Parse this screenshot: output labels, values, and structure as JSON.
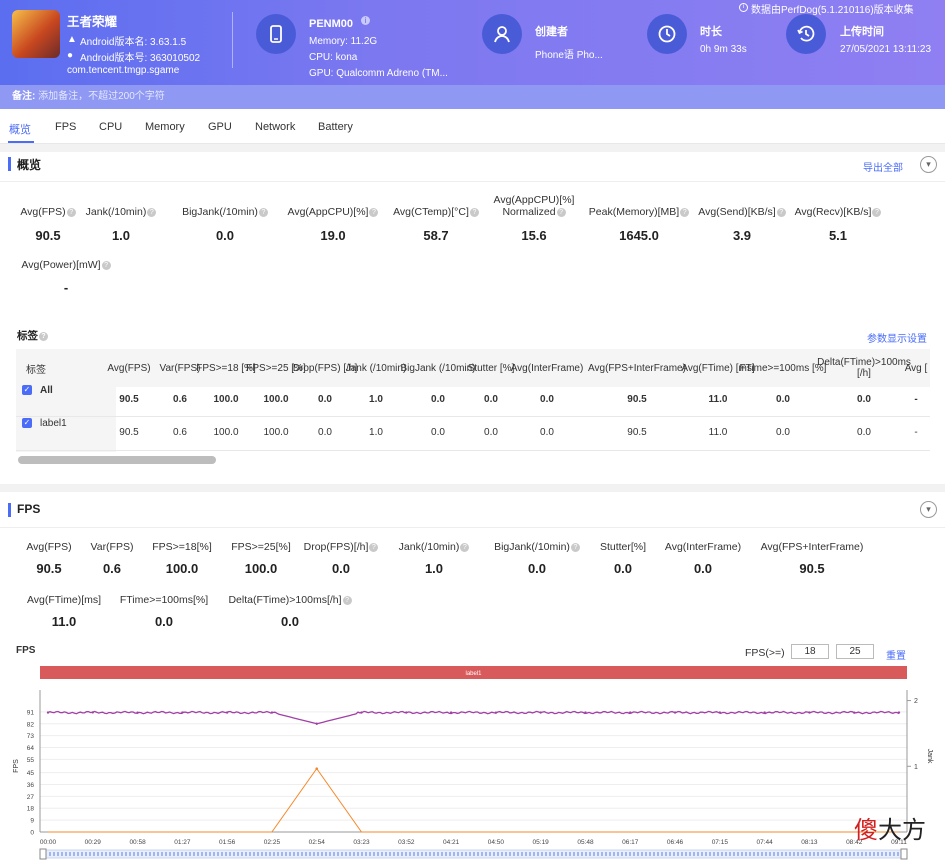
{
  "header": {
    "app_name": "王者荣耀",
    "android_name": "Android版本名: 3.63.1.5",
    "android_code": "Android版本号: 363010502",
    "package": "com.tencent.tmgp.sgame",
    "device": {
      "name": "PENM00",
      "memory": "Memory: 11.2G",
      "cpu": "CPU: kona",
      "gpu": "GPU: Qualcomm Adreno (TM..."
    },
    "creator": {
      "label": "创建者",
      "value": "Phone语 Pho..."
    },
    "duration": {
      "label": "时长",
      "value": "0h 9m 33s"
    },
    "upload": {
      "label": "上传时间",
      "value": "27/05/2021 13:11:23"
    },
    "source": "数据由PerfDog(5.1.210116)版本收集"
  },
  "note": {
    "label": "备注:",
    "placeholder": "添加备注，不超过200个字符"
  },
  "tabs": [
    "概览",
    "FPS",
    "CPU",
    "Memory",
    "GPU",
    "Network",
    "Battery"
  ],
  "overview": {
    "title": "概览",
    "export": "导出全部",
    "metrics": [
      {
        "label": "Avg(FPS)",
        "value": "90.5"
      },
      {
        "label": "Jank(/10min)",
        "value": "1.0"
      },
      {
        "label": "BigJank(/10min)",
        "value": "0.0"
      },
      {
        "label": "Avg(AppCPU)[%]",
        "value": "19.0"
      },
      {
        "label": "Avg(CTemp)[°C]",
        "value": "58.7"
      },
      {
        "label": "Avg(AppCPU)[%]",
        "label2": "Normalized",
        "value": "15.6"
      },
      {
        "label": "Peak(Memory)[MB]",
        "value": "1645.0"
      },
      {
        "label": "Avg(Send)[KB/s]",
        "value": "3.9"
      },
      {
        "label": "Avg(Recv)[KB/s]",
        "value": "5.1"
      },
      {
        "label": "Avg(Power)[mW]",
        "value": "-"
      }
    ]
  },
  "labels": {
    "title": "标签",
    "settings": "参数显示设置",
    "columns": [
      "标签",
      "Avg(FPS)",
      "Var(FPS)",
      "FPS>=18 [%]",
      "FPS>=25 [%]",
      "Drop(FPS) [/h]",
      "Jank (/10min)",
      "BigJank (/10min)",
      "Stutter [%]",
      "Avg(InterFrame)",
      "Avg(FPS+InterFrame)",
      "Avg(FTime) [ms]",
      "FTime>=100ms [%]",
      "Delta(FTime)>100ms [/h]",
      "Avg ["
    ],
    "rows": [
      {
        "name": "All",
        "values": [
          "90.5",
          "0.6",
          "100.0",
          "100.0",
          "0.0",
          "1.0",
          "0.0",
          "0.0",
          "0.0",
          "90.5",
          "11.0",
          "0.0",
          "0.0",
          "-"
        ]
      },
      {
        "name": "label1",
        "values": [
          "90.5",
          "0.6",
          "100.0",
          "100.0",
          "0.0",
          "1.0",
          "0.0",
          "0.0",
          "0.0",
          "90.5",
          "11.0",
          "0.0",
          "0.0",
          "-"
        ]
      }
    ]
  },
  "fps_section": {
    "title": "FPS",
    "metrics": [
      {
        "label": "Avg(FPS)",
        "value": "90.5"
      },
      {
        "label": "Var(FPS)",
        "value": "0.6"
      },
      {
        "label": "FPS>=18[%]",
        "value": "100.0"
      },
      {
        "label": "FPS>=25[%]",
        "value": "100.0"
      },
      {
        "label": "Drop(FPS)[/h]",
        "value": "0.0"
      },
      {
        "label": "Jank(/10min)",
        "value": "1.0"
      },
      {
        "label": "BigJank(/10min)",
        "value": "0.0"
      },
      {
        "label": "Stutter[%]",
        "value": "0.0"
      },
      {
        "label": "Avg(InterFrame)",
        "value": "0.0"
      },
      {
        "label": "Avg(FPS+InterFrame)",
        "value": "90.5"
      },
      {
        "label": "Avg(FTime)[ms]",
        "value": "11.0"
      },
      {
        "label": "FTime>=100ms[%]",
        "value": "0.0"
      },
      {
        "label": "Delta(FTime)>100ms[/h]",
        "value": "0.0"
      }
    ],
    "chart_title": "FPS",
    "fps_threshold_label": "FPS(>=)",
    "fps_threshold_1": "18",
    "fps_threshold_2": "25",
    "reset": "重置",
    "band_label": "label1"
  },
  "chart_data": {
    "type": "line",
    "title": "FPS",
    "ylabel": "FPS",
    "y2label": "Jank",
    "yticks": [
      0,
      9,
      18,
      27,
      36,
      45,
      55,
      64,
      73,
      82,
      91
    ],
    "y2ticks": [
      1,
      2
    ],
    "ylim": [
      0,
      100
    ],
    "x": [
      "00:00",
      "00:29",
      "00:58",
      "01:27",
      "01:56",
      "02:25",
      "02:54",
      "03:23",
      "03:52",
      "04:21",
      "04:50",
      "05:19",
      "05:48",
      "06:17",
      "06:46",
      "07:15",
      "07:44",
      "08:13",
      "08:42",
      "09:11"
    ],
    "series": [
      {
        "name": "FPS",
        "color": "#a13fa6",
        "values": [
          90.5,
          90.6,
          90.4,
          90.5,
          90.5,
          90.5,
          82,
          90.5,
          90.5,
          90.5,
          90.4,
          90.5,
          90.5,
          90.5,
          90.5,
          90.5,
          90.5,
          90.5,
          90.4,
          90.5
        ]
      },
      {
        "name": "Jank",
        "color": "#f5892a",
        "values": [
          0,
          0,
          0,
          0,
          0,
          0,
          1,
          0,
          0,
          0,
          0,
          0,
          0,
          0,
          0,
          0,
          0,
          0,
          0,
          0
        ]
      }
    ],
    "grid": true
  },
  "watermark": {
    "left": "傻",
    "right": "大方"
  },
  "colors": {
    "accent": "#4a6cf7",
    "fps_line": "#a13fa6",
    "jank_line": "#f5892a",
    "label_band": "#d95a5a"
  }
}
